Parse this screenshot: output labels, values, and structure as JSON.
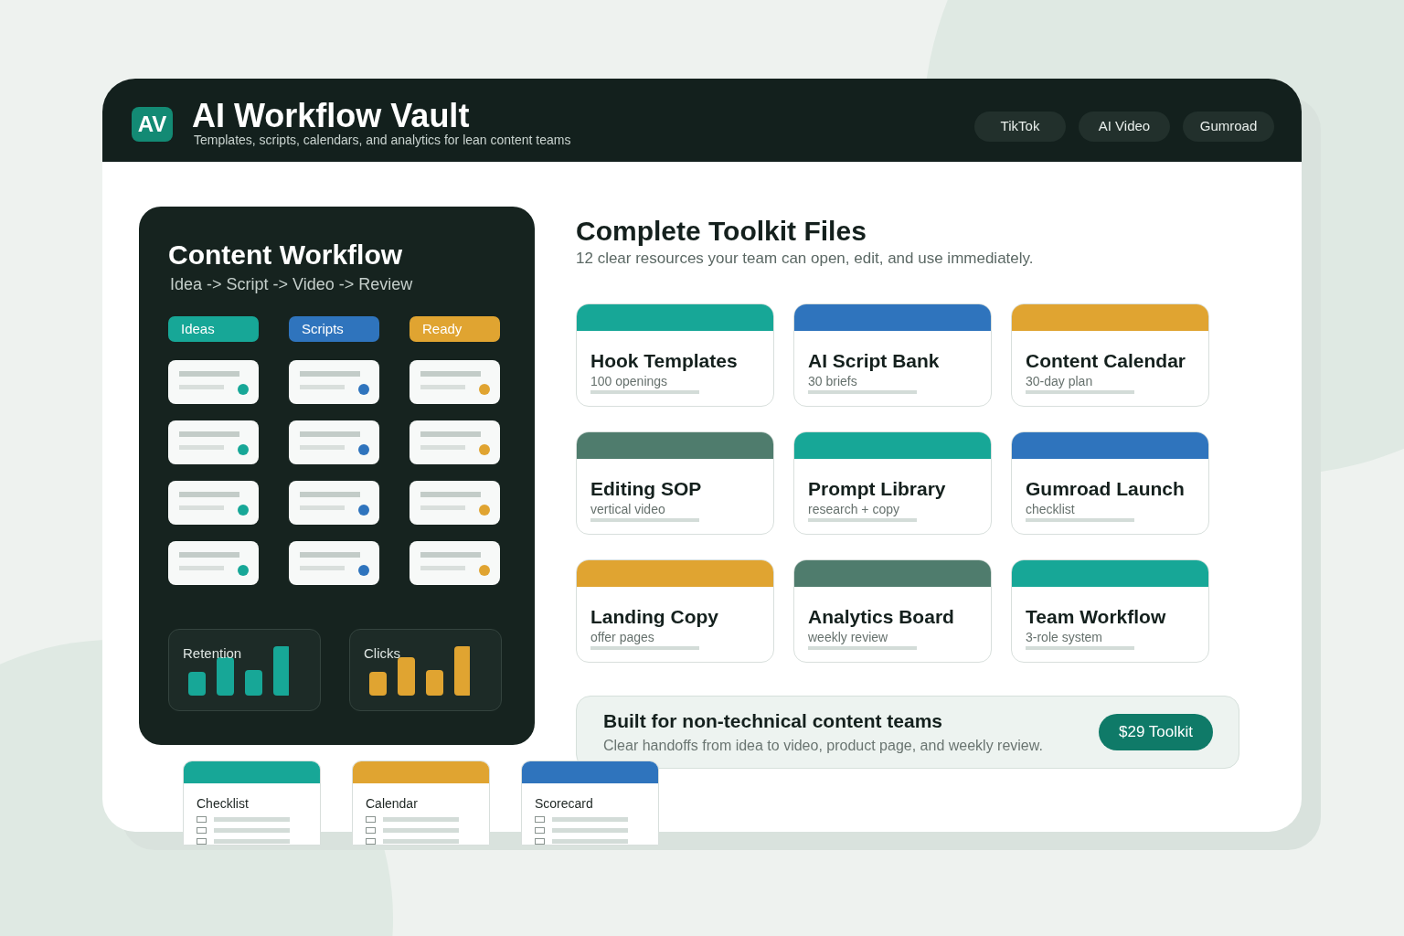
{
  "header": {
    "logo": "AV",
    "title": "AI Workflow Vault",
    "subtitle": "Templates, scripts, calendars, and analytics for lean content teams",
    "nav": [
      "TikTok",
      "AI Video",
      "Gumroad"
    ]
  },
  "workflow": {
    "title": "Content Workflow",
    "steps": "Idea -> Script -> Video -> Review",
    "columns": [
      {
        "label": "Ideas",
        "color": "#17a797"
      },
      {
        "label": "Scripts",
        "color": "#2f74bd"
      },
      {
        "label": "Ready",
        "color": "#e0a431"
      }
    ],
    "metrics": [
      {
        "label": "Retention",
        "color": "#17a797"
      },
      {
        "label": "Clicks",
        "color": "#e0a431"
      }
    ]
  },
  "toolkit": {
    "title": "Complete Toolkit Files",
    "subtitle": "12 clear resources your team can open, edit, and use immediately.",
    "files": [
      {
        "title": "Hook Templates",
        "detail": "100 openings",
        "color": "#17a797"
      },
      {
        "title": "AI Script Bank",
        "detail": "30 briefs",
        "color": "#2f74bd"
      },
      {
        "title": "Content Calendar",
        "detail": "30-day plan",
        "color": "#e0a431"
      },
      {
        "title": "Editing SOP",
        "detail": "vertical video",
        "color": "#4f7c6d"
      },
      {
        "title": "Prompt Library",
        "detail": "research + copy",
        "color": "#17a797"
      },
      {
        "title": "Gumroad Launch",
        "detail": "checklist",
        "color": "#2f74bd"
      },
      {
        "title": "Landing Copy",
        "detail": "offer pages",
        "color": "#e0a431"
      },
      {
        "title": "Analytics Board",
        "detail": "weekly review",
        "color": "#4f7c6d"
      },
      {
        "title": "Team Workflow",
        "detail": "3-role system",
        "color": "#17a797"
      }
    ]
  },
  "banner": {
    "title": "Built for non-technical content teams",
    "text": "Clear handoffs from idea to video, product page, and weekly review.",
    "button": "$29 Toolkit"
  },
  "mini_cards": [
    {
      "label": "Checklist",
      "color": "#17a797",
      "items": [
        {
          "checked": false
        },
        {
          "checked": false
        },
        {
          "checked": false
        }
      ]
    },
    {
      "label": "Calendar",
      "color": "#e0a431",
      "items": [
        {
          "checked": false
        },
        {
          "checked": false
        },
        {
          "checked": false
        }
      ]
    },
    {
      "label": "Scorecard",
      "color": "#2f74bd",
      "items": [
        {
          "checked": false
        },
        {
          "checked": false
        },
        {
          "checked": false
        }
      ]
    }
  ]
}
